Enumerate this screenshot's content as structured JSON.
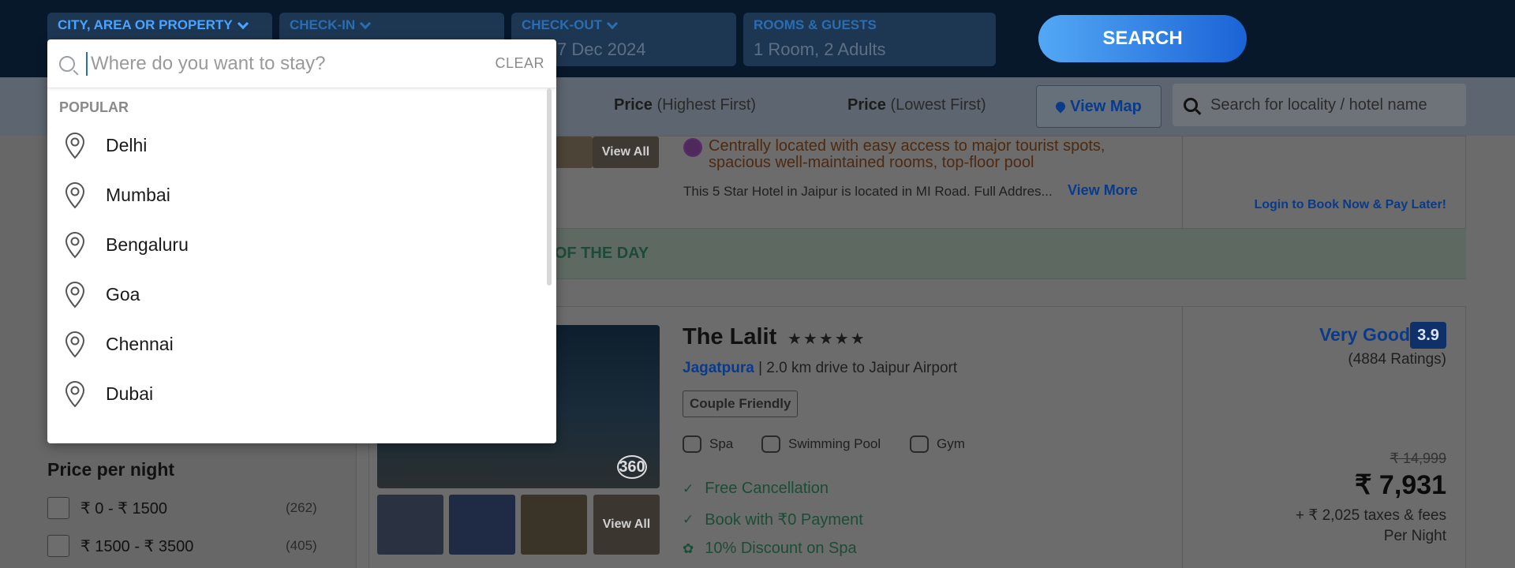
{
  "search": {
    "city_label": "CITY, AREA OR PROPERTY",
    "checkin_label": "CHECK-IN",
    "checkout_label": "CHECK-OUT",
    "checkout_value": "7 Dec 2024",
    "guests_label": "ROOMS & GUESTS",
    "guests_value": "1 Room, 2 Adults",
    "search_button": "SEARCH"
  },
  "dropdown": {
    "placeholder": "Where do you want to stay?",
    "clear_label": "CLEAR",
    "section_title": "POPULAR",
    "cities": [
      "Delhi",
      "Mumbai",
      "Bengaluru",
      "Goa",
      "Chennai",
      "Dubai"
    ]
  },
  "sortbar": {
    "price_high_bold": "Price",
    "price_high_rest": " (Highest First)",
    "price_low_bold": "Price",
    "price_low_rest": " (Lowest First)",
    "view_map": "View Map",
    "locality_placeholder": "Search for locality / hotel name"
  },
  "filters": {
    "price_title": "Price per night",
    "price_ranges": [
      {
        "label": "₹ 0 - ₹ 1500",
        "count": "(262)"
      },
      {
        "label": "₹ 1500 - ₹ 3500",
        "count": "(405)"
      }
    ]
  },
  "hotel1": {
    "view_all": "View All",
    "highlight": "Centrally located with easy access to major tourist spots, spacious well-maintained rooms, top-floor pool",
    "description": "This 5 Star Hotel in Jaipur is located in MI Road. Full Addres...",
    "view_more": "View More",
    "login_note": "Login to Book Now & Pay Later!"
  },
  "deal_banner": "AL OF THE DAY",
  "hotel2": {
    "name": "The Lalit",
    "stars": "★★★★★",
    "area": "Jagatpura",
    "distance": " | 2.0 km drive to Jaipur Airport",
    "tag": "Couple Friendly",
    "amenities": [
      "Spa",
      "Swimming Pool",
      "Gym"
    ],
    "view_all": "View All",
    "badge_360": "360",
    "bullets": [
      "Free Cancellation",
      "Book with ₹0 Payment",
      "10% Discount on Spa"
    ],
    "rating_text": "Very Good",
    "rating_score": "3.9",
    "rating_count": "(4884 Ratings)",
    "old_price": "₹ 14,999",
    "new_price": "₹ 7,931",
    "taxes": "+ ₹ 2,025 taxes & fees",
    "per_night": "Per Night"
  },
  "colors": {
    "topbar_bg": "#07182b",
    "accent_blue": "#2a6db0",
    "search_button": "#1b63d6"
  }
}
